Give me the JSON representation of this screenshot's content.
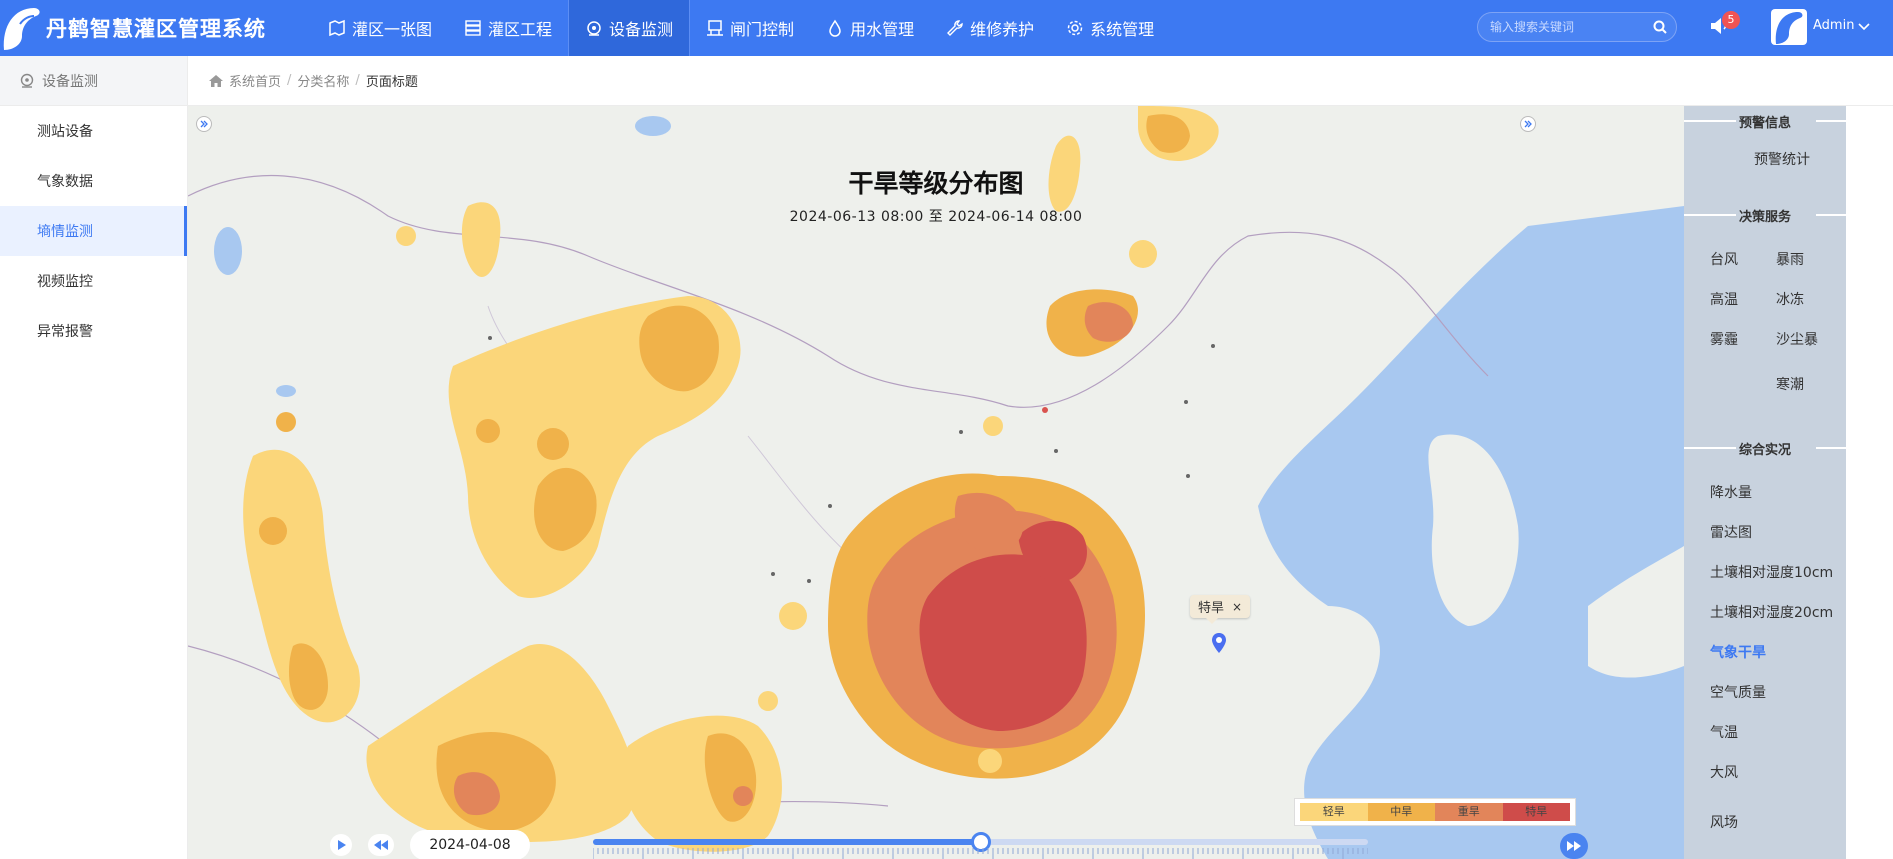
{
  "app": {
    "title": "丹鹤智慧灌区管理系统"
  },
  "nav": [
    {
      "label": "灌区一张图",
      "icon": "map-icon"
    },
    {
      "label": "灌区工程",
      "icon": "server-icon"
    },
    {
      "label": "设备监测",
      "icon": "monitor-icon",
      "active": true
    },
    {
      "label": "闸门控制",
      "icon": "gate-icon"
    },
    {
      "label": "用水管理",
      "icon": "water-drop-icon"
    },
    {
      "label": "维修养护",
      "icon": "wrench-icon"
    },
    {
      "label": "系统管理",
      "icon": "gear-icon"
    }
  ],
  "search": {
    "placeholder": "输入搜索关键词"
  },
  "notifications": {
    "count": "5"
  },
  "user": {
    "name": "Admin"
  },
  "sidebar": {
    "header": "设备监测",
    "items": [
      {
        "label": "测站设备"
      },
      {
        "label": "气象数据"
      },
      {
        "label": "墒情监测",
        "active": true
      },
      {
        "label": "视频监控"
      },
      {
        "label": "异常报警"
      }
    ]
  },
  "breadcrumb": {
    "home": "系统首页",
    "category": "分类名称",
    "page": "页面标题"
  },
  "map": {
    "title": "干旱等级分布图",
    "subtitle": "2024-06-13 08:00 至 2024-06-14 08:00",
    "popup": {
      "label": "特旱",
      "close": "×"
    },
    "legend": [
      {
        "label": "轻旱",
        "color": "#fbd67a"
      },
      {
        "label": "中旱",
        "color": "#f0b24a"
      },
      {
        "label": "重旱",
        "color": "#e2855a"
      },
      {
        "label": "特旱",
        "color": "#cf4c4a"
      }
    ],
    "timeline": {
      "date": "2024-04-08",
      "progress": 0.5
    }
  },
  "right_panel": {
    "sections": [
      {
        "title": "预警信息"
      },
      {
        "title": "决策服务"
      },
      {
        "title": "综合实况"
      }
    ],
    "warning": [
      {
        "label": "预警统计"
      }
    ],
    "decision": [
      {
        "label": "台风"
      },
      {
        "label": "暴雨"
      },
      {
        "label": "高温"
      },
      {
        "label": "冰冻"
      },
      {
        "label": "雾霾"
      },
      {
        "label": "沙尘暴"
      },
      {
        "label": "寒潮"
      }
    ],
    "realtime": [
      {
        "label": "降水量"
      },
      {
        "label": "雷达图"
      },
      {
        "label": "土壤相对湿度10cm"
      },
      {
        "label": "土壤相对湿度20cm"
      },
      {
        "label": "气象干旱",
        "active": true
      },
      {
        "label": "空气质量"
      },
      {
        "label": "气温"
      },
      {
        "label": "大风"
      },
      {
        "label": "风场"
      }
    ]
  }
}
